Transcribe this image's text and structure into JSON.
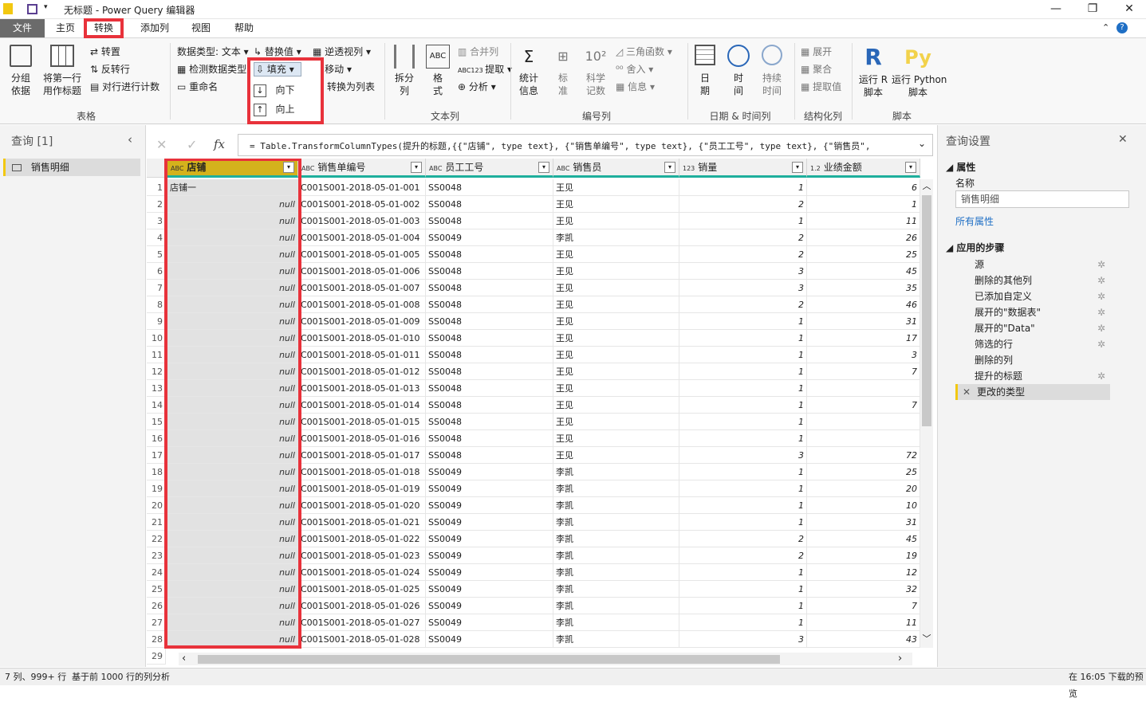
{
  "window": {
    "title": "无标题 - Power Query 编辑器",
    "minimize": "—",
    "restore": "❐",
    "close": "✕"
  },
  "menu": {
    "tabs": [
      "文件",
      "主页",
      "转换",
      "添加列",
      "视图",
      "帮助"
    ]
  },
  "ribbon": {
    "table_group": {
      "group_by": "分组\n依据",
      "first_row_header": "将第一行\n用作标题",
      "transpose": "转置",
      "reverse_rows": "反转行",
      "count_rows": "对行进行计数",
      "label": "表格"
    },
    "any_column": {
      "data_type": "数据类型: 文本",
      "detect_type": "检测数据类型",
      "rename": "重命名",
      "replace_values": "替换值",
      "fill": "填充",
      "fill_down": "向下",
      "fill_up": "向上",
      "unpivot": "逆透视列",
      "move": "移动",
      "to_list": "转换为列表"
    },
    "text_column": {
      "split": "拆分\n列",
      "format": "格\n式",
      "merge": "合并列",
      "extract": "提取",
      "parse": "分析",
      "label": "文本列"
    },
    "number_column": {
      "statistics": "统计\n信息",
      "standard": "标\n准",
      "scientific": "科学\n记数",
      "trig": "三角函数",
      "rounding": "舍入",
      "information": "信息",
      "label": "编号列"
    },
    "datetime": {
      "date": "日\n期",
      "time": "时\n间",
      "duration": "持续\n时间",
      "label": "日期 & 时间列"
    },
    "structured": {
      "expand": "展开",
      "aggregate": "聚合",
      "extract_values": "提取值",
      "label": "结构化列"
    },
    "scripts": {
      "run_r": "运行 R\n脚本",
      "run_python": "运行 Python\n脚本",
      "label": "脚本"
    }
  },
  "left_panel": {
    "title": "查询 [1]",
    "query": "销售明细"
  },
  "formula": {
    "text": "= Table.TransformColumnTypes(提升的标题,{{\"店铺\", type text}, {\"销售单编号\", type text}, {\"员工工号\", type text}, {\"销售员\","
  },
  "grid": {
    "columns": [
      {
        "type": "ABC",
        "name": "店铺"
      },
      {
        "type": "ABC",
        "name": "销售单编号"
      },
      {
        "type": "ABC",
        "name": "员工工号"
      },
      {
        "type": "ABC",
        "name": "销售员"
      },
      {
        "type": "123",
        "name": "销量"
      },
      {
        "type": "1.2",
        "name": "业绩金额"
      }
    ],
    "rows": [
      [
        "店铺一",
        "C001S001-2018-05-01-001",
        "SS0048",
        "王见",
        "1",
        "6"
      ],
      [
        "null",
        "C001S001-2018-05-01-002",
        "SS0048",
        "王见",
        "2",
        "1"
      ],
      [
        "null",
        "C001S001-2018-05-01-003",
        "SS0048",
        "王见",
        "1",
        "11"
      ],
      [
        "null",
        "C001S001-2018-05-01-004",
        "SS0049",
        "李凯",
        "2",
        "26"
      ],
      [
        "null",
        "C001S001-2018-05-01-005",
        "SS0048",
        "王见",
        "2",
        "25"
      ],
      [
        "null",
        "C001S001-2018-05-01-006",
        "SS0048",
        "王见",
        "3",
        "45"
      ],
      [
        "null",
        "C001S001-2018-05-01-007",
        "SS0048",
        "王见",
        "3",
        "35"
      ],
      [
        "null",
        "C001S001-2018-05-01-008",
        "SS0048",
        "王见",
        "2",
        "46"
      ],
      [
        "null",
        "C001S001-2018-05-01-009",
        "SS0048",
        "王见",
        "1",
        "31"
      ],
      [
        "null",
        "C001S001-2018-05-01-010",
        "SS0048",
        "王见",
        "1",
        "17"
      ],
      [
        "null",
        "C001S001-2018-05-01-011",
        "SS0048",
        "王见",
        "1",
        "3"
      ],
      [
        "null",
        "C001S001-2018-05-01-012",
        "SS0048",
        "王见",
        "1",
        "7"
      ],
      [
        "null",
        "C001S001-2018-05-01-013",
        "SS0048",
        "王见",
        "1",
        ""
      ],
      [
        "null",
        "C001S001-2018-05-01-014",
        "SS0048",
        "王见",
        "1",
        "7"
      ],
      [
        "null",
        "C001S001-2018-05-01-015",
        "SS0048",
        "王见",
        "1",
        ""
      ],
      [
        "null",
        "C001S001-2018-05-01-016",
        "SS0048",
        "王见",
        "1",
        ""
      ],
      [
        "null",
        "C001S001-2018-05-01-017",
        "SS0048",
        "王见",
        "3",
        "72"
      ],
      [
        "null",
        "C001S001-2018-05-01-018",
        "SS0049",
        "李凯",
        "1",
        "25"
      ],
      [
        "null",
        "C001S001-2018-05-01-019",
        "SS0049",
        "李凯",
        "1",
        "20"
      ],
      [
        "null",
        "C001S001-2018-05-01-020",
        "SS0049",
        "李凯",
        "1",
        "10"
      ],
      [
        "null",
        "C001S001-2018-05-01-021",
        "SS0049",
        "李凯",
        "1",
        "31"
      ],
      [
        "null",
        "C001S001-2018-05-01-022",
        "SS0049",
        "李凯",
        "2",
        "45"
      ],
      [
        "null",
        "C001S001-2018-05-01-023",
        "SS0049",
        "李凯",
        "2",
        "19"
      ],
      [
        "null",
        "C001S001-2018-05-01-024",
        "SS0049",
        "李凯",
        "1",
        "12"
      ],
      [
        "null",
        "C001S001-2018-05-01-025",
        "SS0049",
        "李凯",
        "1",
        "32"
      ],
      [
        "null",
        "C001S001-2018-05-01-026",
        "SS0049",
        "李凯",
        "1",
        "7"
      ],
      [
        "null",
        "C001S001-2018-05-01-027",
        "SS0049",
        "李凯",
        "1",
        "11"
      ],
      [
        "null",
        "C001S001-2018-05-01-028",
        "SS0049",
        "李凯",
        "3",
        "43"
      ]
    ],
    "last_row_number": "29"
  },
  "right_panel": {
    "title": "查询设置",
    "properties_label": "属性",
    "name_label": "名称",
    "name_value": "销售明细",
    "all_properties": "所有属性",
    "steps_label": "应用的步骤",
    "steps": [
      {
        "name": "源",
        "gear": true
      },
      {
        "name": "删除的其他列",
        "gear": true
      },
      {
        "name": "已添加自定义",
        "gear": true
      },
      {
        "name": "展开的\"数据表\"",
        "gear": true
      },
      {
        "name": "展开的\"Data\"",
        "gear": true
      },
      {
        "name": "筛选的行",
        "gear": true
      },
      {
        "name": "删除的列",
        "gear": false
      },
      {
        "name": "提升的标题",
        "gear": true
      },
      {
        "name": "更改的类型",
        "gear": false
      }
    ]
  },
  "status": {
    "left": "7 列、999+ 行",
    "profile": "基于前 1000 行的列分析",
    "right": "在 16:05 下载的预览"
  },
  "colors": {
    "accent": "#1eaf9c",
    "highlight_red": "#e8323b",
    "selected_header": "#d4b21c"
  }
}
